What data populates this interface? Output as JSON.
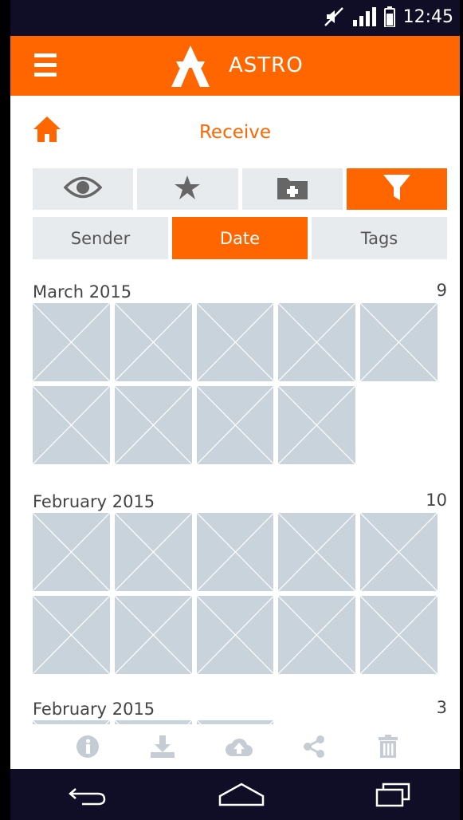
{
  "status_bar": {
    "time": "12:45",
    "icons": [
      "mute-icon",
      "signal-icon",
      "battery-icon"
    ]
  },
  "app_bar": {
    "brand": "ASTRO",
    "menu_icon": "hamburger-icon",
    "logo_icon": "astro-logo"
  },
  "page": {
    "title": "Receive",
    "home_icon": "home-icon"
  },
  "view_toolbar": {
    "buttons": [
      {
        "icon": "eye-icon",
        "active": false
      },
      {
        "icon": "star-icon",
        "active": false
      },
      {
        "icon": "folder-add-icon",
        "active": false
      },
      {
        "icon": "filter-icon",
        "active": true
      }
    ]
  },
  "sort_tabs": [
    {
      "label": "Sender",
      "active": false
    },
    {
      "label": "Date",
      "active": true
    },
    {
      "label": "Tags",
      "active": false
    }
  ],
  "sections": [
    {
      "title": "March 2015",
      "count": "9"
    },
    {
      "title": "February 2015",
      "count": "10"
    },
    {
      "title": "February 2015",
      "count": "3"
    }
  ],
  "bottom_actions": [
    "info-icon",
    "download-icon",
    "upload-icon",
    "share-icon",
    "delete-icon"
  ],
  "system_nav": [
    "back-icon",
    "home-nav-icon",
    "recents-icon"
  ],
  "colors": {
    "accent": "#ff6600",
    "system_bar": "#0f0e26",
    "tile": "#c9d3db",
    "button_bg": "#e8ebee",
    "icon_gray": "#c5ccd3"
  }
}
